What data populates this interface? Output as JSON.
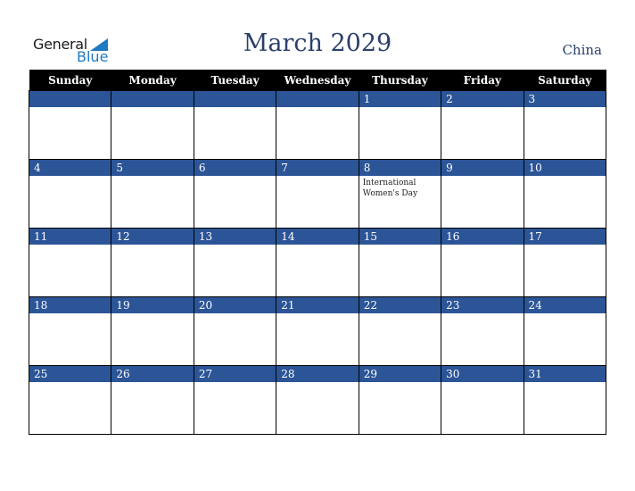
{
  "logo": {
    "word1": "General",
    "word2": "Blue"
  },
  "title": "March 2029",
  "country": "China",
  "weekdays": [
    "Sunday",
    "Monday",
    "Tuesday",
    "Wednesday",
    "Thursday",
    "Friday",
    "Saturday"
  ],
  "weeks": [
    [
      {
        "d": ""
      },
      {
        "d": ""
      },
      {
        "d": ""
      },
      {
        "d": ""
      },
      {
        "d": "1"
      },
      {
        "d": "2"
      },
      {
        "d": "3"
      }
    ],
    [
      {
        "d": "4"
      },
      {
        "d": "5"
      },
      {
        "d": "6"
      },
      {
        "d": "7"
      },
      {
        "d": "8",
        "event": "International Women's Day"
      },
      {
        "d": "9"
      },
      {
        "d": "10"
      }
    ],
    [
      {
        "d": "11"
      },
      {
        "d": "12"
      },
      {
        "d": "13"
      },
      {
        "d": "14"
      },
      {
        "d": "15"
      },
      {
        "d": "16"
      },
      {
        "d": "17"
      }
    ],
    [
      {
        "d": "18"
      },
      {
        "d": "19"
      },
      {
        "d": "20"
      },
      {
        "d": "21"
      },
      {
        "d": "22"
      },
      {
        "d": "23"
      },
      {
        "d": "24"
      }
    ],
    [
      {
        "d": "25"
      },
      {
        "d": "26"
      },
      {
        "d": "27"
      },
      {
        "d": "28"
      },
      {
        "d": "29"
      },
      {
        "d": "30"
      },
      {
        "d": "31"
      }
    ]
  ]
}
